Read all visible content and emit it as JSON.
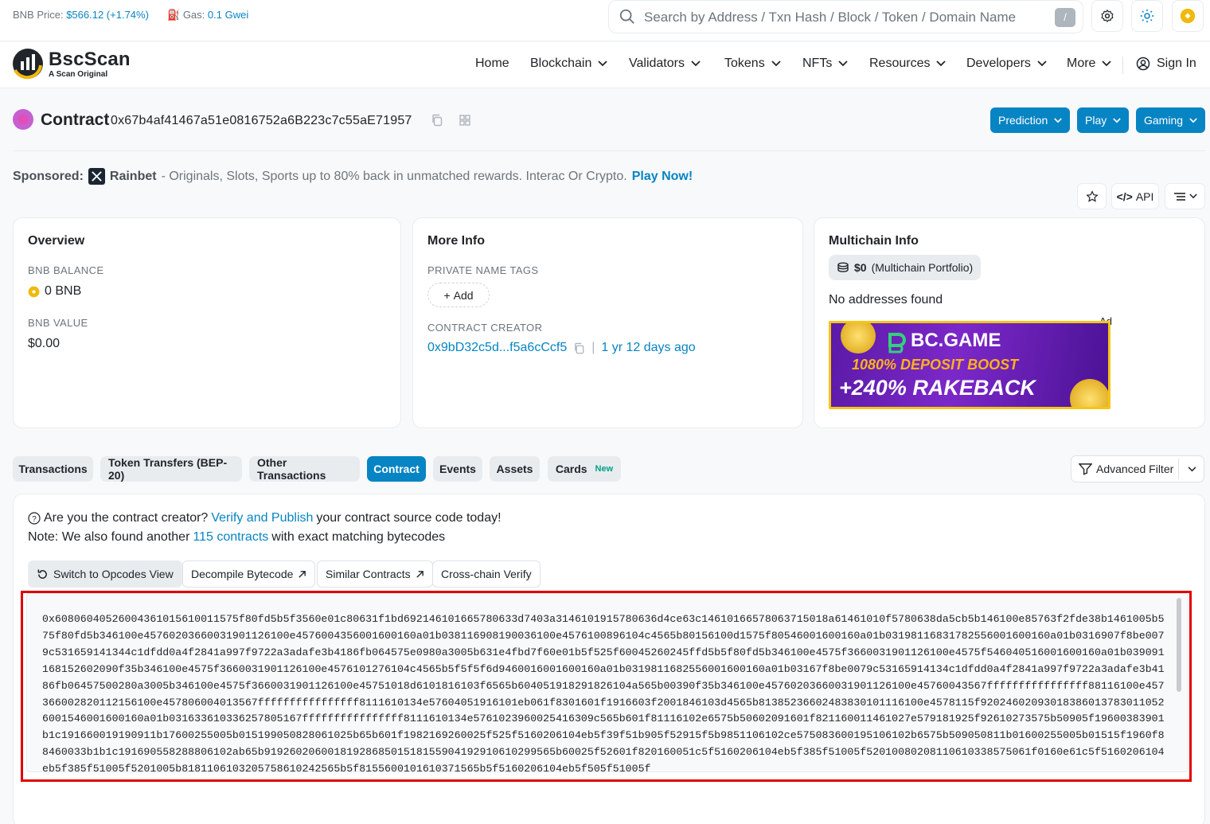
{
  "topbar": {
    "price_label": "BNB Price:",
    "price_value": "$566.12 (+1.74%)",
    "gas_label": "Gas:",
    "gas_value": "0.1 Gwei",
    "search_placeholder": "Search by Address / Txn Hash / Block / Token / Domain Name",
    "search_shortcut": "/"
  },
  "nav": {
    "brand": "BscScan",
    "tagline": "A Scan Original",
    "items": [
      "Home",
      "Blockchain",
      "Validators",
      "Tokens",
      "NFTs",
      "Resources",
      "Developers",
      "More"
    ],
    "sign_in": "Sign In"
  },
  "header": {
    "title": "Contract",
    "address": "0x67b4af41467a51e0816752a6B223c7c55aE71957",
    "buttons": [
      "Prediction",
      "Play",
      "Gaming"
    ]
  },
  "sponsor": {
    "label": "Sponsored:",
    "brand": "Rainbet",
    "text": "- Originals, Slots, Sports up to 80% back in unmatched rewards. Interac Or Crypto.",
    "cta": "Play Now!"
  },
  "actions": {
    "api": "API"
  },
  "overview": {
    "title": "Overview",
    "balance_label": "BNB BALANCE",
    "balance_value": "0 BNB",
    "value_label": "BNB VALUE",
    "value_value": "$0.00"
  },
  "more_info": {
    "title": "More Info",
    "tags_label": "PRIVATE NAME TAGS",
    "add_label": "Add",
    "creator_label": "CONTRACT CREATOR",
    "creator_address": "0x9bD32c5d...f5a6cCcf5",
    "creator_age": "1 yr 12 days ago"
  },
  "multichain": {
    "title": "Multichain Info",
    "portfolio_value": "$0",
    "portfolio_label": "(Multichain Portfolio)",
    "no_addresses": "No addresses found",
    "ad_tag": "Ad",
    "ad_brand": "BC.GAME",
    "ad_line1": "1080% DEPOSIT BOOST",
    "ad_line2": "+240% RAKEBACK"
  },
  "tabs": [
    {
      "label": "Transactions"
    },
    {
      "label": "Token Transfers (BEP-20)"
    },
    {
      "label": "Other Transactions"
    },
    {
      "label": "Contract"
    },
    {
      "label": "Events"
    },
    {
      "label": "Assets"
    },
    {
      "label": "Cards",
      "badge": "New"
    }
  ],
  "advanced_filter": "Advanced Filter",
  "contract": {
    "q_text": "Are you the contract creator?",
    "q_link": "Verify and Publish",
    "q_rest": "your contract source code today!",
    "note_text": "Note: We also found another",
    "note_link": "115 contracts",
    "note_rest": "with exact matching bytecodes",
    "tools": [
      "Switch to Opcodes View",
      "Decompile Bytecode",
      "Similar Contracts",
      "Cross-chain Verify"
    ],
    "bytecode": "0x6080604052600436101561001157​5f80fd5b5f3560e01c80631f1bd69214610166578063​3d7403a31461019157806​36d4ce63c146101665780637​15018a61461010f578063​8da5cb5b146100e85763f2fde38b1461005b575f80fd5b346100e457602036600319011261​00e4576004356001600160a01b0381169081900361​00e457610089​6104c4565b80156100d1575f80546001600160a01b03198116831782556001600160a01b0316907f8be0079c531659141344c1dfdd0a4f2841a997f9722a3adafe3b4186fb064575e0980a3005b631e4fbd7f60e01b5f525f60045260245ffd5b5f80fd5b346100e4575f3660031901126100e4575f546040516001600160a01b0390911681526020​90f35b346100e4575f366003190112​6100e457610127​6104c4565b5f5f5f6d9460016001600160a01b031981168255600160​0160a01b03167f8be0079c531659141​34c1dfdd0a4f2841a997f9722a3adafe3b4186fb0645​7500280a3005b346100e4575f3660031901126100e457​5101​8d6101816103f6565b60405191829182​6104a565b0039​0f35b346100e45760203660031901126100e45760043567​ffffffffffffffff8811​6100e457366002820112​156100e457806004013567ffffffffffffffff811161​0134e57604051​9161​01eb061f8301601f1916603f​2001846103d4565b81​3852366024838301011161​00e4578115f92024602093​0183860137830110526001546001600160a01b0316​33​61033625780​5167ffffffffffffffff811161​0134e5761023960025416309c565b601f81116102e657​5b50602091601f821160011461027e579181925f926102​73575b50905f1960​0383901b1c19166001919091​1b17600255005b0151​99050828061025b65b601f19821692600​25f525f5160206104​eb5f39f51b905f52915f5b98511061​02ce5750​83600195106102b6575b509050811b0160025​5005b01515f1960f88460033b1b1c1916905582888​06102ab65b9192602060​01819286850151815590419​2910610299565b60025f52601f820160051c5f5160206104eb5f385f51005f520100802081106103385750​61f0160e61c5f516020610​4eb5f385f51005f5201005b818110610320575​8610242565b5f8155600101610371565b5f516020610​4eb5f505f51005f"
  }
}
